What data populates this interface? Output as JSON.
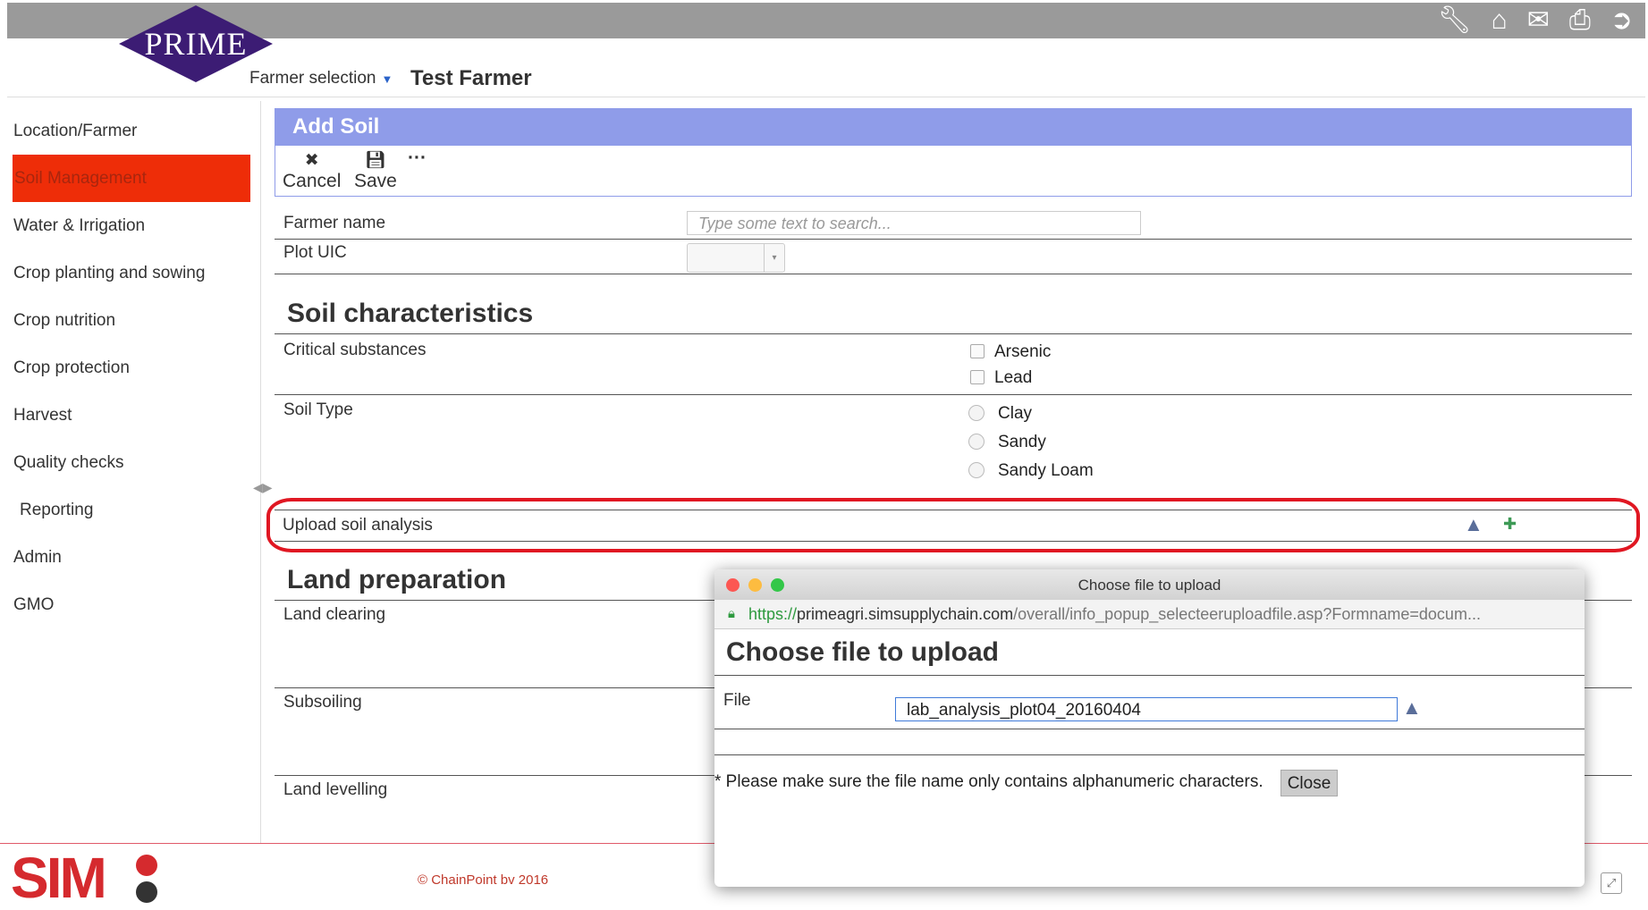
{
  "header": {
    "logo_text": "PRIME",
    "farmer_selection_label": "Farmer selection",
    "farmer_name": "Test Farmer",
    "icons": [
      "wrench-icon",
      "home-icon",
      "mail-icon",
      "print-icon",
      "logout-icon"
    ]
  },
  "sidebar": {
    "items": [
      {
        "label": "Location/Farmer"
      },
      {
        "label": "Soil Management",
        "active": true
      },
      {
        "label": "Water & Irrigation"
      },
      {
        "label": "Crop planting and sowing"
      },
      {
        "label": "Crop nutrition"
      },
      {
        "label": "Crop protection"
      },
      {
        "label": "Harvest"
      },
      {
        "label": "Quality checks"
      },
      {
        "label": "Reporting"
      },
      {
        "label": "Admin"
      },
      {
        "label": "GMO"
      }
    ]
  },
  "form": {
    "title": "Add Soil",
    "toolbar": {
      "cancel_label": "Cancel",
      "save_label": "Save",
      "more_label": "···"
    },
    "farmer_name_label": "Farmer name",
    "farmer_name_placeholder": "Type some text to search...",
    "plot_uic_label": "Plot UIC",
    "soil_section_title": "Soil characteristics",
    "critical_label": "Critical substances",
    "critical_options": [
      "Arsenic",
      "Lead"
    ],
    "soil_type_label": "Soil Type",
    "soil_type_options": [
      "Clay",
      "Sandy",
      "Sandy Loam"
    ],
    "upload_label": "Upload soil analysis",
    "land_section_title": "Land preparation",
    "land_rows": [
      "Land clearing",
      "Subsoiling",
      "Land levelling"
    ]
  },
  "popup": {
    "window_title": "Choose file to upload",
    "url_secure": "https://",
    "url_host": "primeagri.simsupplychain.com",
    "url_path": "/overall/info_popup_selecteeruploadfile.asp?Formname=docum...",
    "heading": "Choose file to upload",
    "file_label": "File",
    "file_value": "lab_analysis_plot04_20160404",
    "note": "* Please make sure the file name only contains alphanumeric characters.",
    "close_label": "Close"
  },
  "footer": {
    "copyright": "© ChainPoint bv 2016",
    "logo_text": "SIM"
  },
  "colors": {
    "active_nav": "#ee2d08",
    "panel_header": "#8f9ce9",
    "highlight_ring": "#e01722",
    "logo_purple": "#3c1c74"
  }
}
